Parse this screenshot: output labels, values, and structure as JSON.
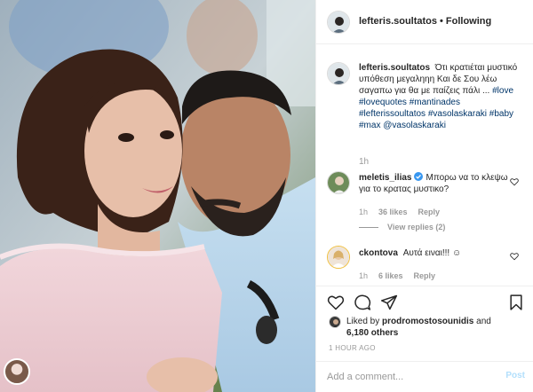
{
  "post": {
    "username": "lefteris.soultatos",
    "follow_status": "Following"
  },
  "caption": {
    "username": "lefteris.soultatos",
    "text": "Ότι κρατιέται μυστικό υπόθεση μεγαληηη Και δε Σου λέω σαγαπω για θα με παίζεις πάλι ...",
    "hashtags": [
      "#love",
      "#lovequotes",
      "#mantinades",
      "#lefterissoultatos",
      "#vasolaskaraki",
      "#baby",
      "#max"
    ],
    "mention": "@vasolaskaraki",
    "time": "1h"
  },
  "comments": [
    {
      "username": "meletis_ilias",
      "verified": true,
      "text": "Μπορω να το κλεψω για το κρατας μυστικο?",
      "time": "1h",
      "likes": "36 likes",
      "reply": "Reply",
      "view_replies": "View replies (2)"
    },
    {
      "username": "ckontova",
      "text": "Αυτά ειναι!!! ☺",
      "time": "1h",
      "likes": "6 likes",
      "reply": "Reply"
    }
  ],
  "likes_summary": {
    "prefix": "Liked by",
    "user": "prodromostosounidis",
    "and": "and",
    "others": "6,180 others"
  },
  "time_ago": "1 HOUR AGO",
  "add_comment": {
    "placeholder": "Add a comment...",
    "post_label": "Post"
  },
  "icons": {
    "like": "heart-icon",
    "comment": "comment-icon",
    "share": "share-icon",
    "save": "bookmark-icon"
  },
  "colors": {
    "link": "#003569",
    "muted": "#999999",
    "post_disabled": "#b2dffc",
    "verified": "#3897f0"
  }
}
